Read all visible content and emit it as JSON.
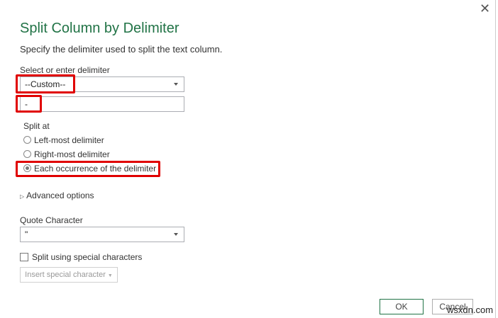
{
  "dialog": {
    "title": "Split Column by Delimiter",
    "description": "Specify the delimiter used to split the text column.",
    "close_icon": "close-icon"
  },
  "delimiter": {
    "label": "Select or enter delimiter",
    "selected": "--Custom--",
    "custom_value": "-"
  },
  "split_at": {
    "label": "Split at",
    "options": [
      {
        "label": "Left-most delimiter",
        "selected": false
      },
      {
        "label": "Right-most delimiter",
        "selected": false
      },
      {
        "label": "Each occurrence of the delimiter",
        "selected": true
      }
    ]
  },
  "advanced": {
    "label": "Advanced options"
  },
  "quote": {
    "label": "Quote Character",
    "selected": "\""
  },
  "special": {
    "checkbox_label": "Split using special characters",
    "checked": false,
    "insert_button": "Insert special character"
  },
  "buttons": {
    "ok": "OK",
    "cancel": "Cancel"
  },
  "watermark": "wsxdn.com",
  "colors": {
    "title": "#217346",
    "highlight": "#e00000",
    "ok_border": "#217346"
  }
}
